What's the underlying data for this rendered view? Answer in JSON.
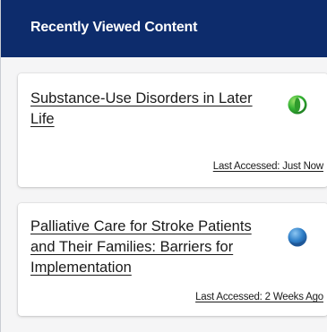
{
  "panel": {
    "title": "Recently Viewed Content"
  },
  "items": [
    {
      "title": "Substance-Use Disorders in Later Life",
      "last_accessed": "Last Accessed: Just Now",
      "icon": "progress-partial-green-icon",
      "icon_color": "#34b233"
    },
    {
      "title": "Palliative Care for Stroke Patients and Their Families: Barriers for Implementation",
      "last_accessed": "Last Accessed: 2 Weeks Ago",
      "icon": "progress-blue-icon",
      "icon_color": "#2f7fc8"
    }
  ],
  "colors": {
    "header_bg": "#0d2c6c",
    "body_bg": "#f5f5f6",
    "card_bg": "#ffffff"
  }
}
